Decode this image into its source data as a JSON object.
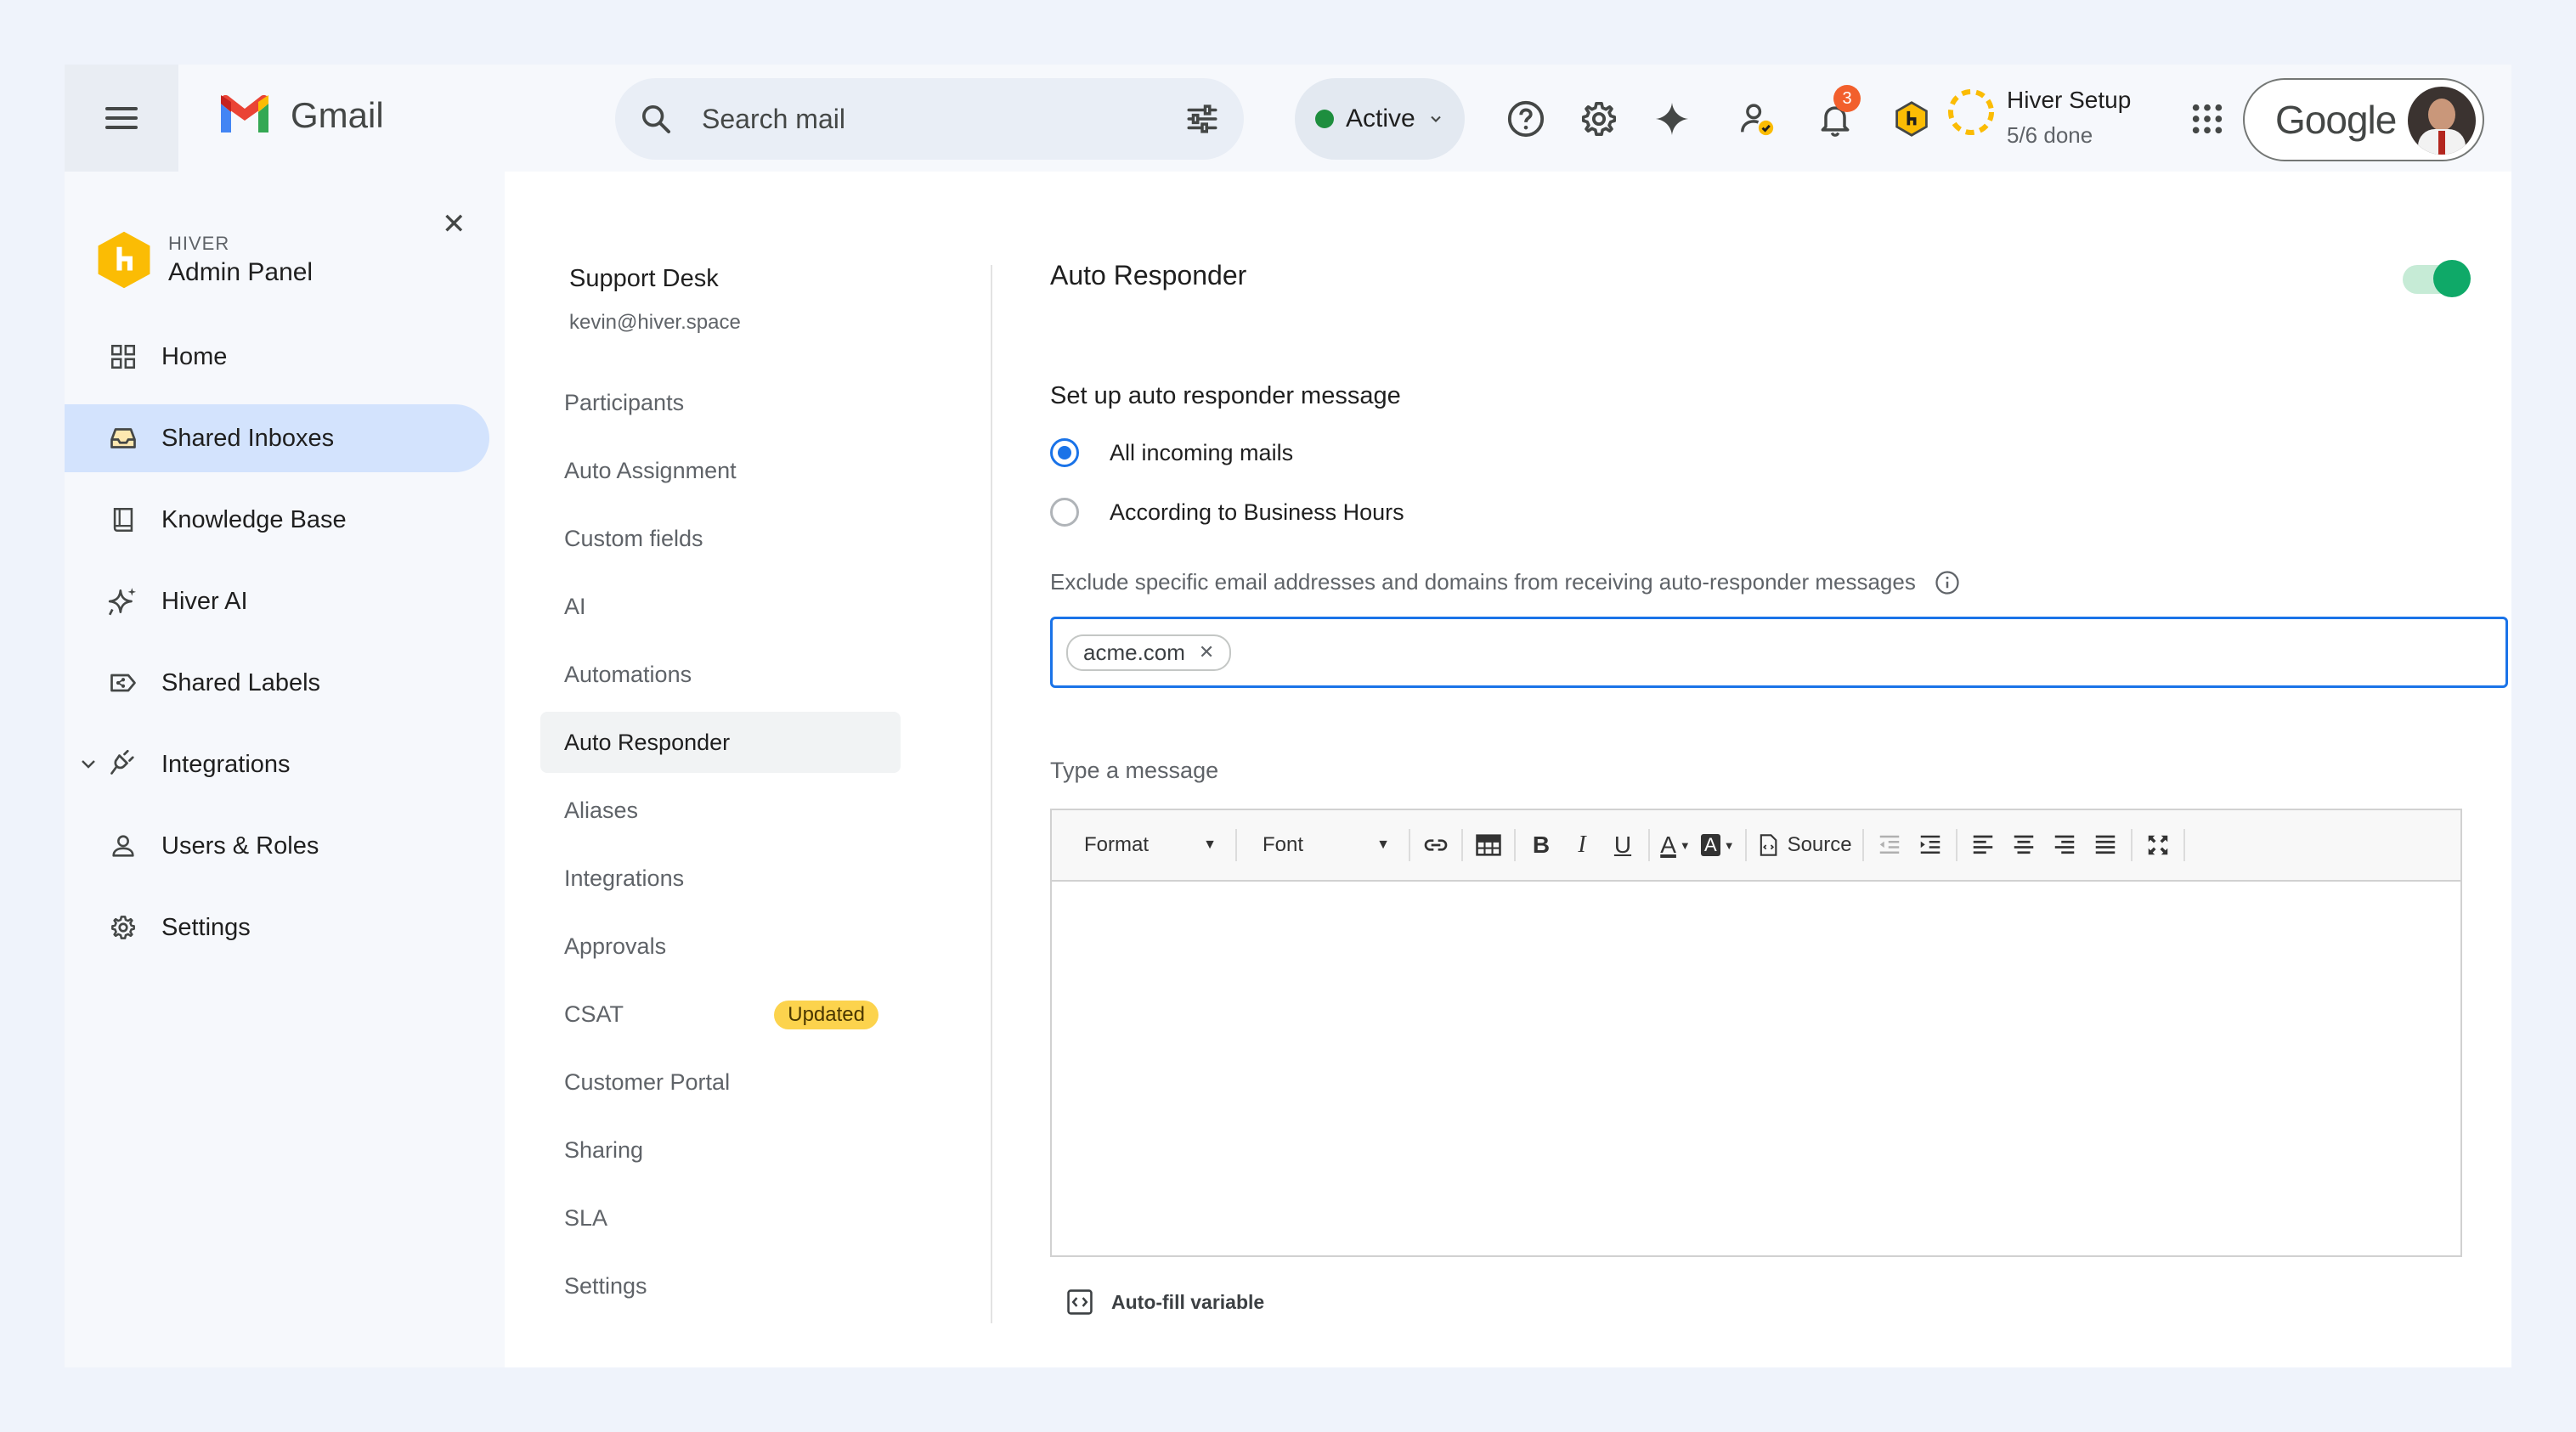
{
  "topbar": {
    "app_name": "Gmail",
    "search_placeholder": "Search mail",
    "status": "Active",
    "notification_count": "3",
    "setup_title": "Hiver Setup",
    "setup_progress": "5/6 done",
    "setup_fraction": 0.833,
    "account_brand": "Google",
    "icons": [
      "menu-icon",
      "search-icon",
      "filter-options-icon",
      "help-icon",
      "settings-icon",
      "gemini-icon",
      "contacts-check-icon",
      "bell-icon",
      "hiver-icon",
      "apps-grid-icon"
    ]
  },
  "sidebar": {
    "brand_small": "HIVER",
    "brand_title": "Admin Panel",
    "items": [
      {
        "label": "Home",
        "icon": "grid-icon"
      },
      {
        "label": "Shared Inboxes",
        "icon": "inbox-icon",
        "active": true
      },
      {
        "label": "Knowledge Base",
        "icon": "book-icon"
      },
      {
        "label": "Hiver AI",
        "icon": "sparkle-icon"
      },
      {
        "label": "Shared Labels",
        "icon": "label-share-icon"
      },
      {
        "label": "Integrations",
        "icon": "plug-icon"
      },
      {
        "label": "Users & Roles",
        "icon": "user-icon"
      },
      {
        "label": "Settings",
        "icon": "gear-icon"
      }
    ]
  },
  "inbox": {
    "name": "Support Desk",
    "email": "kevin@hiver.space",
    "menu": [
      {
        "label": "Participants"
      },
      {
        "label": "Auto Assignment"
      },
      {
        "label": "Custom fields"
      },
      {
        "label": "AI"
      },
      {
        "label": "Automations"
      },
      {
        "label": "Auto Responder",
        "active": true
      },
      {
        "label": "Aliases"
      },
      {
        "label": "Integrations"
      },
      {
        "label": "Approvals"
      },
      {
        "label": "CSAT",
        "badge": "Updated"
      },
      {
        "label": "Customer Portal"
      },
      {
        "label": "Sharing"
      },
      {
        "label": "SLA"
      },
      {
        "label": "Settings"
      }
    ]
  },
  "responder": {
    "title": "Auto Responder",
    "enabled": true,
    "setup_label": "Set up auto responder message",
    "options": [
      {
        "label": "All incoming mails",
        "selected": true
      },
      {
        "label": "According to Business Hours",
        "selected": false
      }
    ],
    "exclude_label": "Exclude specific email addresses and domains from receiving auto-responder messages",
    "excluded_domains": [
      "acme.com"
    ],
    "message_label": "Type a message",
    "editor": {
      "format_label": "Format",
      "font_label": "Font",
      "source_label": "Source"
    },
    "autofill_label": "Auto-fill variable"
  },
  "colors": {
    "accent_blue": "#1a73e8",
    "toggle_green": "#0fa968",
    "active_nav": "#d3e3fd",
    "badge_yellow": "#fcd34d",
    "notification_orange": "#f25f2c"
  }
}
